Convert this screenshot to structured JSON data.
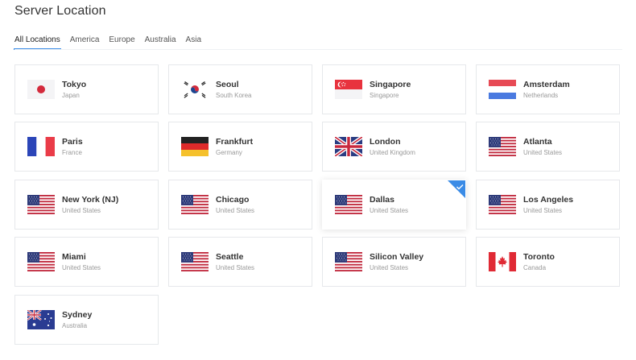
{
  "page": {
    "title": "Server Location"
  },
  "tabs": [
    {
      "label": "All Locations",
      "active": true
    },
    {
      "label": "America",
      "active": false
    },
    {
      "label": "Europe",
      "active": false
    },
    {
      "label": "Australia",
      "active": false
    },
    {
      "label": "Asia",
      "active": false
    }
  ],
  "locations": [
    {
      "city": "Tokyo",
      "country": "Japan",
      "flag": "japan-flag-icon"
    },
    {
      "city": "Seoul",
      "country": "South Korea",
      "flag": "south-korea-flag-icon"
    },
    {
      "city": "Singapore",
      "country": "Singapore",
      "flag": "singapore-flag-icon"
    },
    {
      "city": "Amsterdam",
      "country": "Netherlands",
      "flag": "netherlands-flag-icon"
    },
    {
      "city": "Paris",
      "country": "France",
      "flag": "france-flag-icon"
    },
    {
      "city": "Frankfurt",
      "country": "Germany",
      "flag": "germany-flag-icon"
    },
    {
      "city": "London",
      "country": "United Kingdom",
      "flag": "uk-flag-icon"
    },
    {
      "city": "Atlanta",
      "country": "United States",
      "flag": "usa-flag-icon"
    },
    {
      "city": "New York (NJ)",
      "country": "United States",
      "flag": "usa-flag-icon"
    },
    {
      "city": "Chicago",
      "country": "United States",
      "flag": "usa-flag-icon"
    },
    {
      "city": "Dallas",
      "country": "United States",
      "flag": "usa-flag-icon",
      "selected": true
    },
    {
      "city": "Los Angeles",
      "country": "United States",
      "flag": "usa-flag-icon"
    },
    {
      "city": "Miami",
      "country": "United States",
      "flag": "usa-flag-icon"
    },
    {
      "city": "Seattle",
      "country": "United States",
      "flag": "usa-flag-icon"
    },
    {
      "city": "Silicon Valley",
      "country": "United States",
      "flag": "usa-flag-icon"
    },
    {
      "city": "Toronto",
      "country": "Canada",
      "flag": "canada-flag-icon"
    },
    {
      "city": "Sydney",
      "country": "Australia",
      "flag": "australia-flag-icon"
    }
  ],
  "colors": {
    "accent": "#3a8be6",
    "border": "#e6e8eb",
    "title": "#333333",
    "subtext": "#999999"
  }
}
